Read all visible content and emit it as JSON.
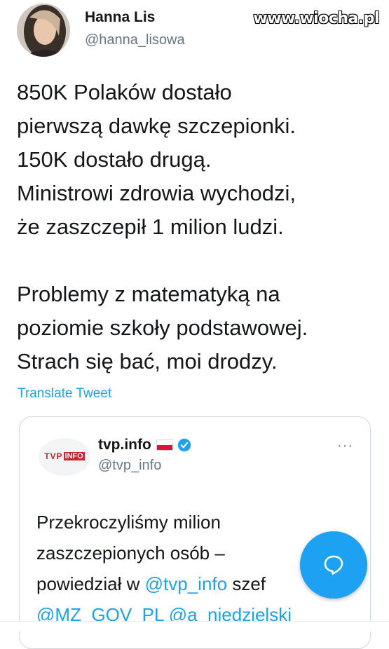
{
  "watermark": "www.wiocha.pl",
  "author": {
    "name": "Hanna Lis",
    "handle": "@hanna_lisowa"
  },
  "tweet": {
    "lines_p1": [
      "850K Polaków dostało",
      "pierwszą dawkę szczepionki.",
      "150K dostało drugą.",
      "Ministrowi zdrowia wychodzi,",
      "że zaszczepił 1 milion ludzi."
    ],
    "lines_p2": [
      "Problemy z matematyką na",
      "poziomie szkoły podstawowej.",
      "Strach się bać, moi drodzy."
    ],
    "translate_label": "Translate Tweet"
  },
  "quoted": {
    "logo_tvp": "TVP",
    "logo_info": "INFO",
    "name": "tvp.info",
    "handle": "@tvp_info",
    "text_line1": "Przekroczyliśmy milion",
    "text_line2": "zaszczepionych osób –",
    "text_line3_prefix": "powiedział w ",
    "text_line3_mention": "@tvp_info",
    "text_line3_suffix": " szef",
    "text_line4_mention1": "@MZ_GOV_PL",
    "text_line4_mention2": "@a_niedzielski",
    "more_label": "···"
  },
  "colors": {
    "accent": "#1da1f2",
    "text": "#14171a",
    "secondary": "#657786",
    "tvp_red": "#d71e2c"
  },
  "icons": {
    "fab": "reply-bubble-icon",
    "verified": "verified-badge-icon",
    "flag": "poland-flag-icon",
    "more": "more-dots-icon"
  }
}
